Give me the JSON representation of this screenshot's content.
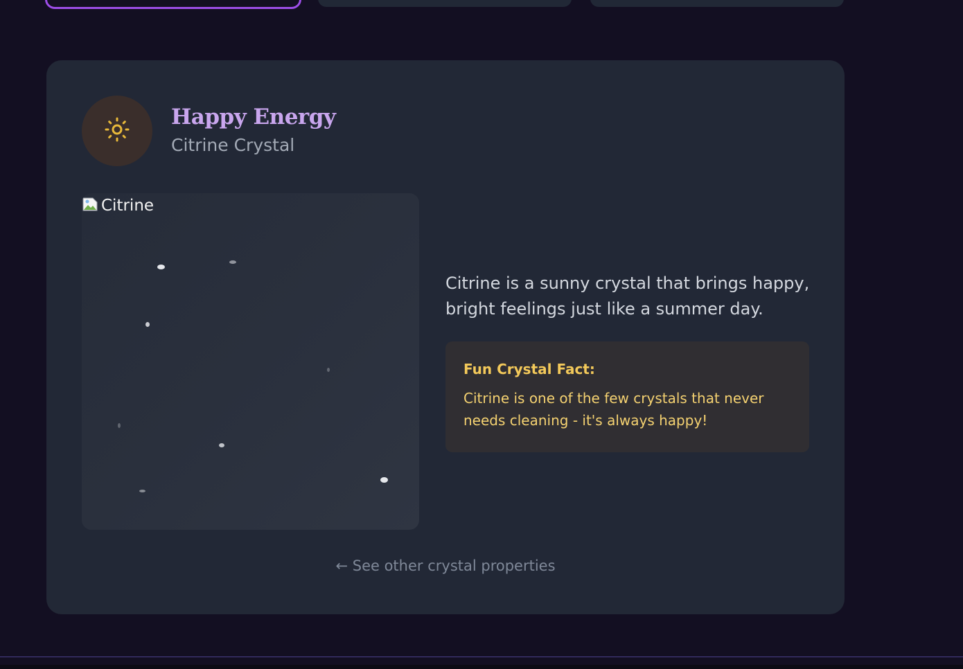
{
  "card": {
    "title": "Happy Energy",
    "subtitle": "Citrine Crystal",
    "icon": "sun-icon",
    "image_alt": "Citrine",
    "description": "Citrine is a sunny crystal that brings happy, bright feelings just like a summer day.",
    "fact_title": "Fun Crystal Fact:",
    "fact_text": "Citrine is one of the few crystals that never needs cleaning - it's always happy!",
    "back_link": "← See other crystal properties"
  },
  "colors": {
    "background": "#130f22",
    "card": "#222836",
    "title": "#c9a6ee",
    "accent_tab": "#9d4ee8",
    "icon": "#e8b93a",
    "fact_text": "#f5d271"
  }
}
